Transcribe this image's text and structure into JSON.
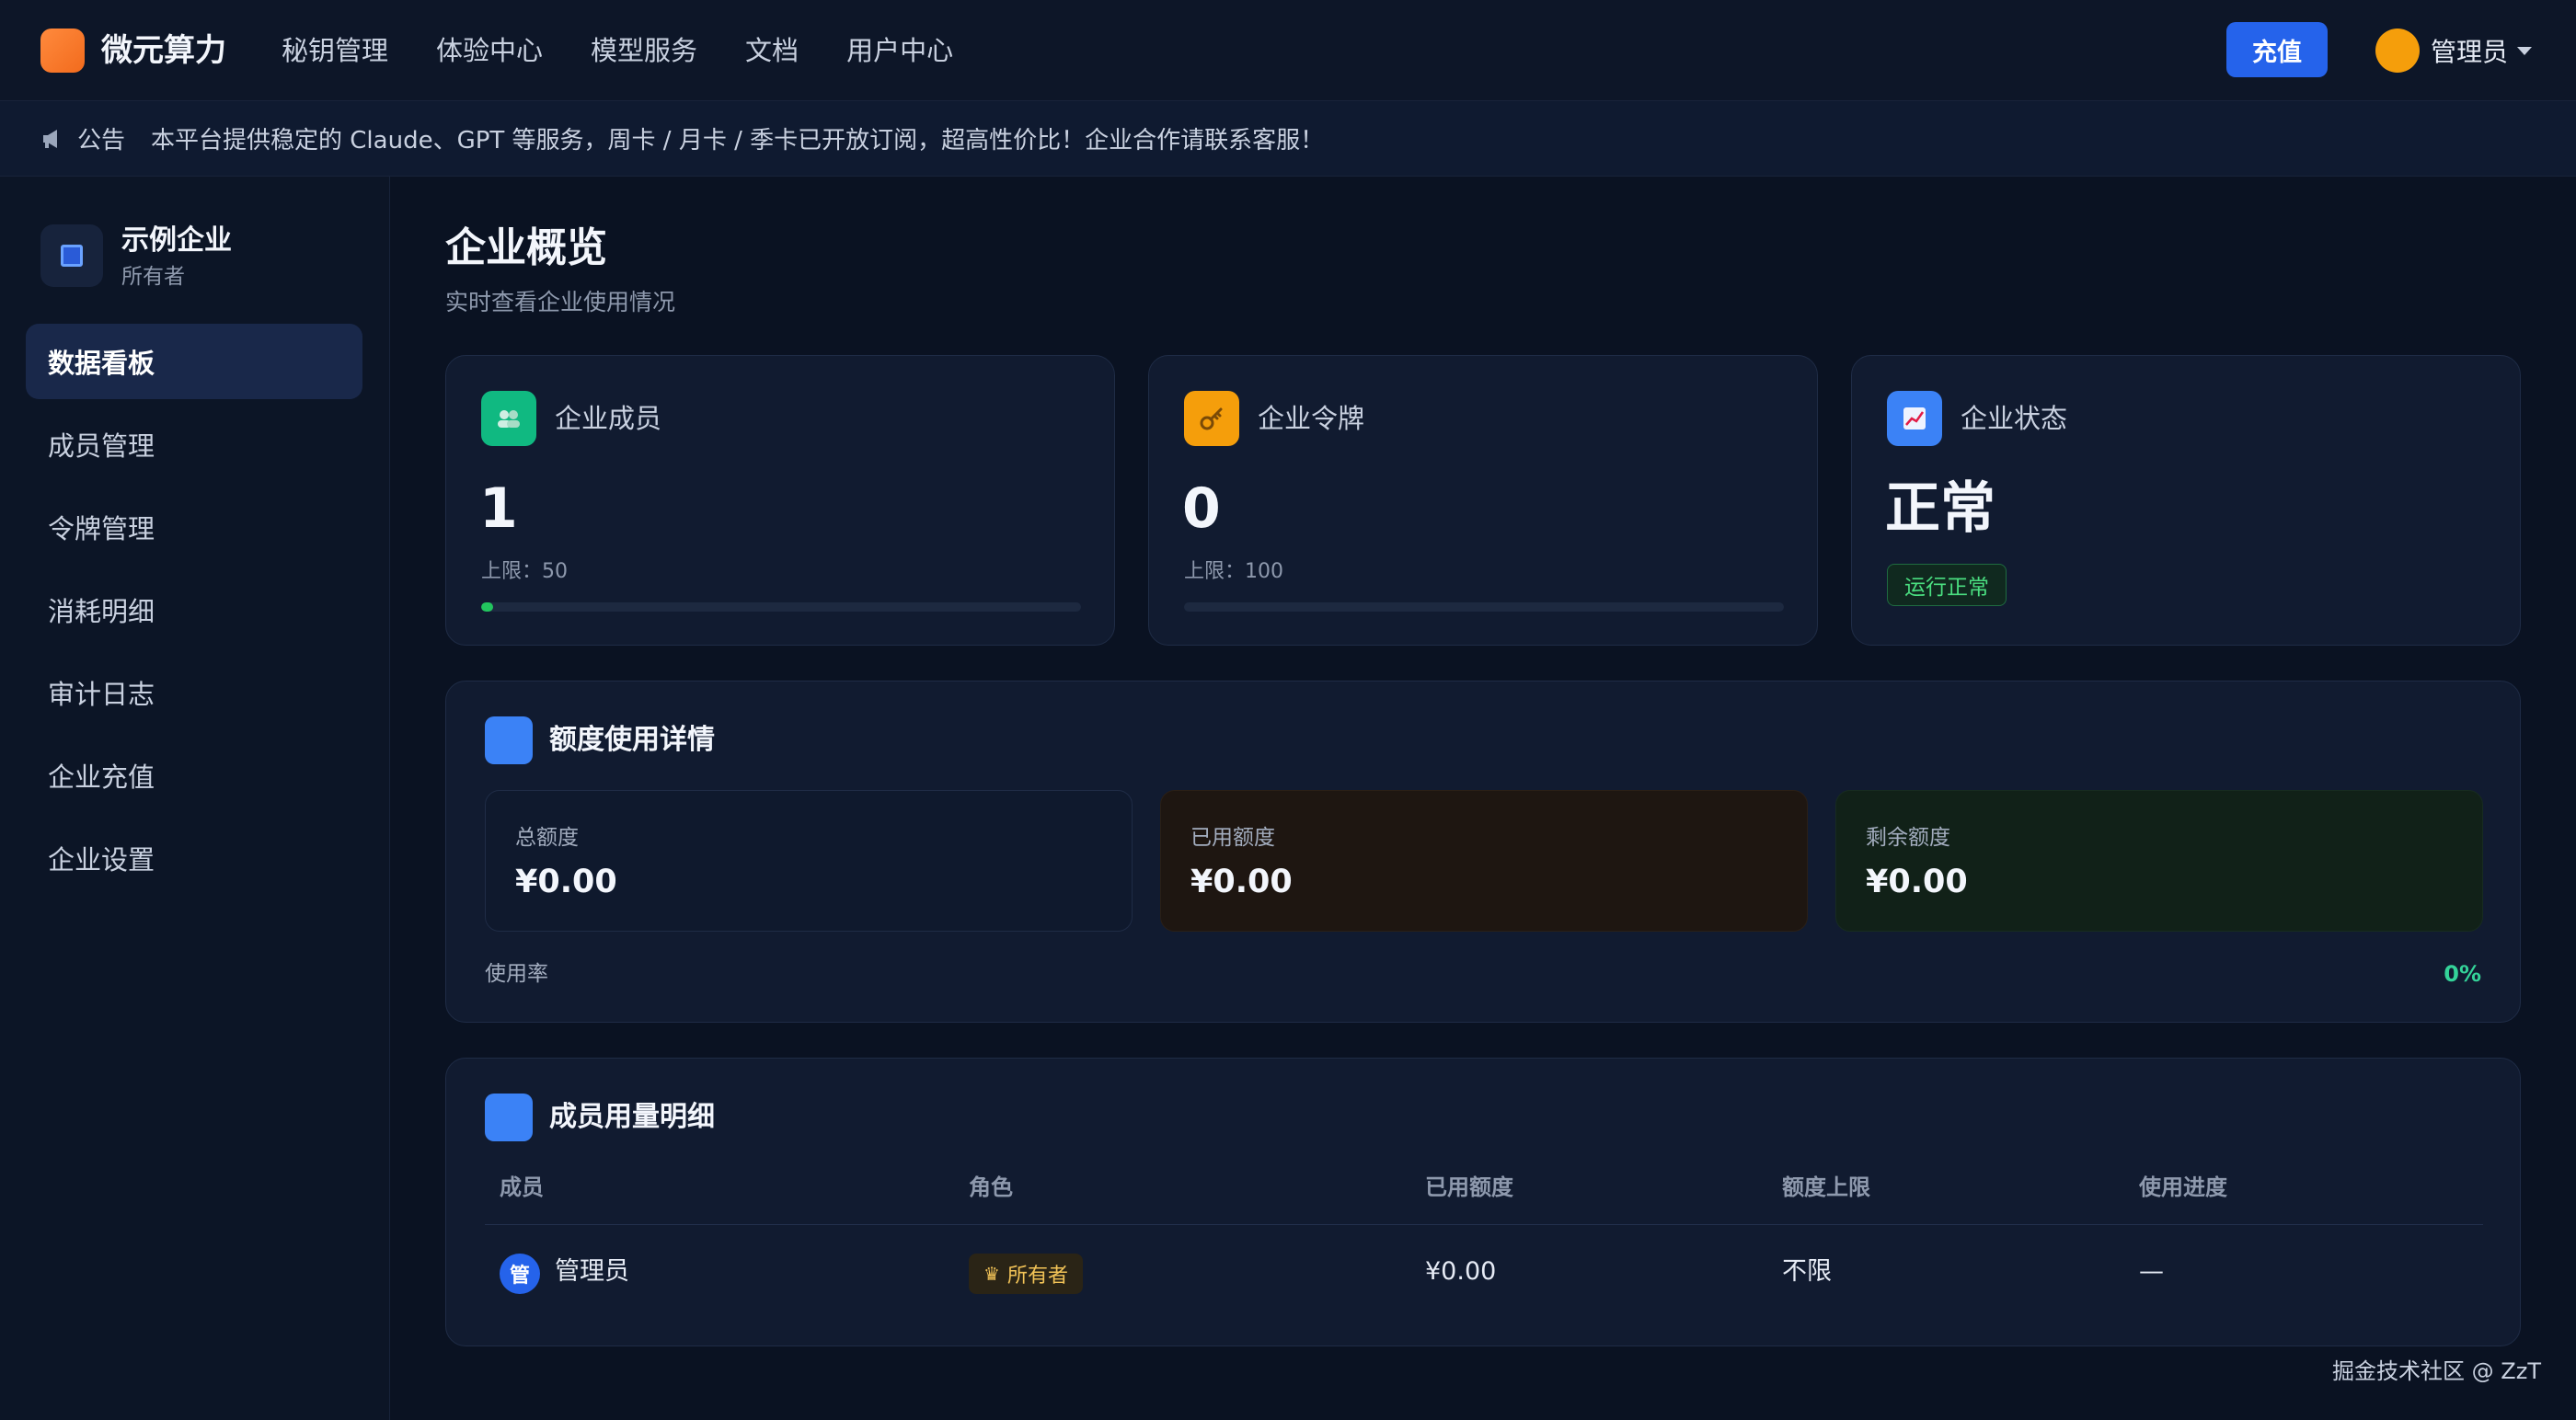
{
  "header": {
    "brand": "微元算力",
    "nav": [
      "秘钥管理",
      "体验中心",
      "模型服务",
      "文档",
      "用户中心"
    ],
    "recharge_label": "充值",
    "user_name": "管理员"
  },
  "announcement": {
    "tag": "公告",
    "text": "本平台提供稳定的 Claude、GPT 等服务，周卡 / 月卡 / 季卡已开放订阅，超高性价比！企业合作请联系客服！"
  },
  "sidebar": {
    "org_name": "示例企业",
    "org_role": "所有者",
    "items": [
      {
        "label": "数据看板",
        "active": true
      },
      {
        "label": "成员管理",
        "active": false
      },
      {
        "label": "令牌管理",
        "active": false
      },
      {
        "label": "消耗明细",
        "active": false
      },
      {
        "label": "审计日志",
        "active": false
      },
      {
        "label": "企业充值",
        "active": false
      },
      {
        "label": "企业设置",
        "active": false
      }
    ]
  },
  "page": {
    "title": "企业概览",
    "subtitle": "实时查看企业使用情况"
  },
  "stats": {
    "members": {
      "label": "企业成员",
      "value": "1",
      "limit": "上限：50",
      "progress": 0.02,
      "icon": "users-icon",
      "color": "#10b981"
    },
    "tokens": {
      "label": "企业令牌",
      "value": "0",
      "limit": "上限：100",
      "progress": 0,
      "icon": "key-icon",
      "color": "#f59e0b"
    },
    "status": {
      "label": "企业状态",
      "value": "正常",
      "badge": "运行正常",
      "icon": "chart-icon",
      "color": "#3b82f6"
    }
  },
  "quota": {
    "title": "额度使用详情",
    "total_label": "总额度",
    "total_value": "¥0.00",
    "used_label": "已用额度",
    "used_value": "¥0.00",
    "remaining_label": "剩余额度",
    "remaining_value": "¥0.00",
    "usage_label": "使用率",
    "usage_value": "0%"
  },
  "members_table": {
    "title": "成员用量明细",
    "columns": [
      "成员",
      "角色",
      "已用额度",
      "额度上限",
      "使用进度"
    ],
    "rows": [
      {
        "avatar": "管",
        "name": "管理员",
        "role": "所有者",
        "used": "¥0.00",
        "limit": "不限",
        "progress": "—"
      }
    ]
  },
  "watermark": "掘金技术社区 @ ZzT",
  "colors": {
    "accent": "#2563eb",
    "success": "#22c55e",
    "warning": "#f59e0b",
    "background": "#0a1222"
  }
}
